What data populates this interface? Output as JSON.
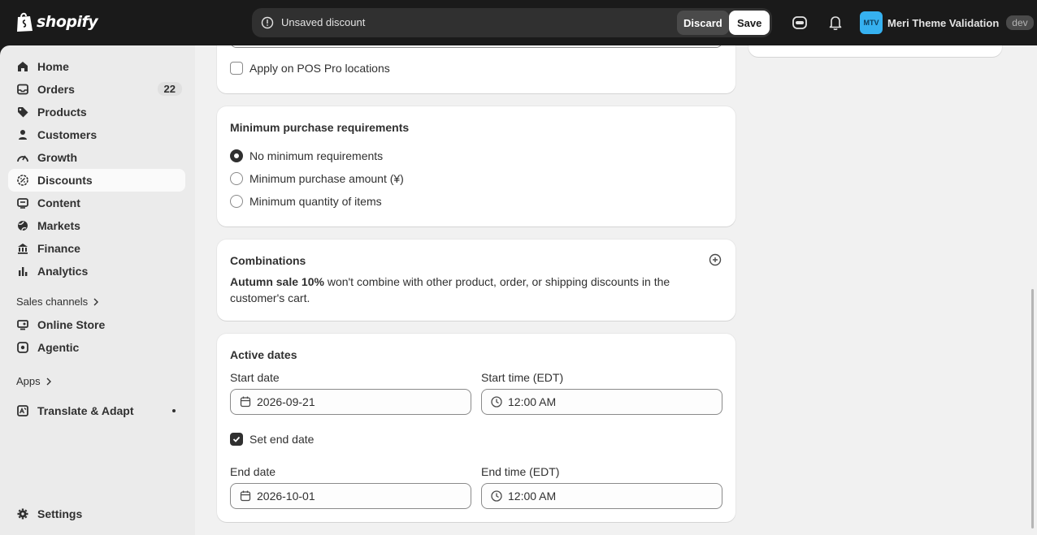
{
  "brand": {
    "name": "shopify"
  },
  "topbar": {
    "unsaved_message": "Unsaved discount",
    "discard_label": "Discard",
    "save_label": "Save",
    "store_initials": "MTV",
    "store_name": "Meri Theme Validation",
    "store_badge": "dev"
  },
  "sidebar": {
    "items": [
      {
        "label": "Home",
        "icon": "home-icon"
      },
      {
        "label": "Orders",
        "icon": "inbox-icon",
        "badge": "22"
      },
      {
        "label": "Products",
        "icon": "tag-icon"
      },
      {
        "label": "Customers",
        "icon": "person-icon"
      },
      {
        "label": "Growth",
        "icon": "gauge-icon"
      },
      {
        "label": "Discounts",
        "icon": "discount-icon",
        "active": true
      },
      {
        "label": "Content",
        "icon": "content-icon"
      },
      {
        "label": "Markets",
        "icon": "globe-icon"
      },
      {
        "label": "Finance",
        "icon": "bank-icon"
      },
      {
        "label": "Analytics",
        "icon": "bar-chart-icon"
      }
    ],
    "sales_channels_label": "Sales channels",
    "channels": [
      {
        "label": "Online Store",
        "icon": "store-icon"
      },
      {
        "label": "Agentic",
        "icon": "agentic-icon"
      }
    ],
    "apps_label": "Apps",
    "apps": [
      {
        "label": "Translate & Adapt",
        "icon": "translate-icon"
      }
    ],
    "settings_label": "Settings"
  },
  "pos": {
    "label": "Apply on POS Pro locations",
    "checked": false
  },
  "minimum": {
    "title": "Minimum purchase requirements",
    "options": [
      {
        "label": "No minimum requirements",
        "checked": true
      },
      {
        "label": "Minimum purchase amount (¥)",
        "checked": false
      },
      {
        "label": "Minimum quantity of items",
        "checked": false
      }
    ]
  },
  "combinations": {
    "title": "Combinations",
    "discount_name": "Autumn sale 10%",
    "text": " won't combine with other product, order, or shipping discounts in the customer's cart."
  },
  "active_dates": {
    "title": "Active dates",
    "start_date_label": "Start date",
    "start_date": "2026-09-21",
    "start_time_label": "Start time (EDT)",
    "start_time": "12:00 AM",
    "set_end_label": "Set end date",
    "set_end_checked": true,
    "end_date_label": "End date",
    "end_date": "2026-10-01",
    "end_time_label": "End time (EDT)",
    "end_time": "12:00 AM"
  }
}
